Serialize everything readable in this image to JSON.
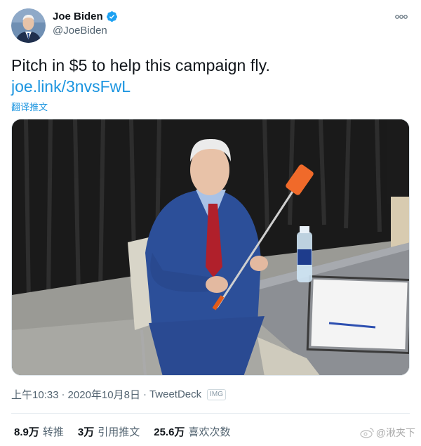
{
  "user": {
    "display_name": "Joe Biden",
    "handle": "@JoeBiden",
    "verified": true,
    "avatar_icon": "avatar-photo"
  },
  "tweet": {
    "text": "Pitch in $5 to help this campaign fly.",
    "link": "joe.link/3nvsFwL",
    "translate_label": "翻译推文"
  },
  "media": {
    "description_icon": "campaign-photo"
  },
  "meta": {
    "time": "上午10:33",
    "separator1": "·",
    "date": "2020年10月8日",
    "separator2": "·",
    "source": "TweetDeck",
    "badge": "IMG"
  },
  "stats": {
    "retweets": {
      "count": "8.9万",
      "label": "转推"
    },
    "quotes": {
      "count": "3万",
      "label": "引用推文"
    },
    "likes": {
      "count": "25.6万",
      "label": "喜欢次数"
    }
  },
  "watermark": {
    "text": "@湫夹下"
  },
  "colors": {
    "link": "#1b95e0",
    "verified": "#1da1f2",
    "secondary_text": "#536471"
  }
}
